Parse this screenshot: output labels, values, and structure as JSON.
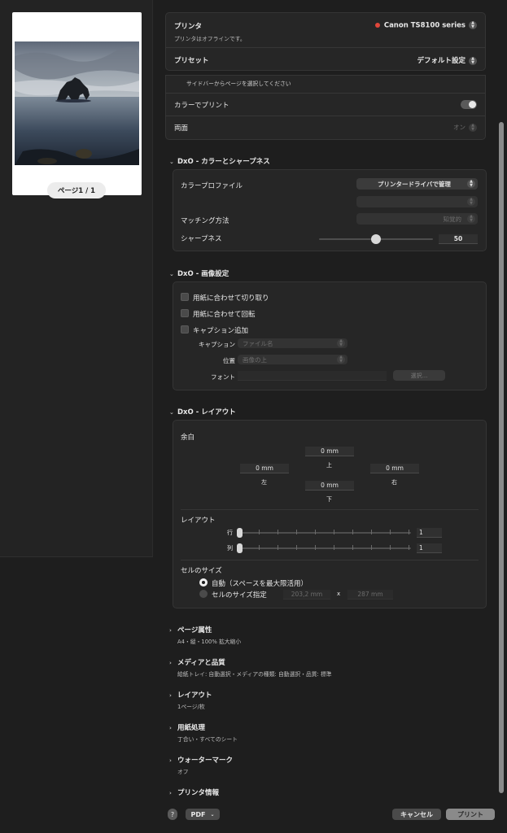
{
  "preview": {
    "page_indicator": "ページ1 / 1"
  },
  "printer": {
    "label": "プリンタ",
    "value": "Canon TS8100 series",
    "status": "プリンタはオフラインです。",
    "status_color": "#e0463a"
  },
  "preset": {
    "label": "プリセット",
    "value": "デフォルト設定"
  },
  "general": {
    "hint": "サイドバーからページを選択してください",
    "color_print_label": "カラーでプリント",
    "color_print_on": true,
    "duplex_label": "両面",
    "duplex_value": "オン"
  },
  "color_sharpness": {
    "title": "DxO - カラーとシャープネス",
    "profile_label": "カラープロファイル",
    "profile_value": "プリンタードライバで管理",
    "matching_label": "マッチング方法",
    "matching_value": "知覚的",
    "sharpness_label": "シャープネス",
    "sharpness_value": "50",
    "sharpness_level": 0.5
  },
  "image_settings": {
    "title": "DxO - 画像設定",
    "crop_label": "用紙に合わせて切り取り",
    "rotate_label": "用紙に合わせて回転",
    "caption_add_label": "キャプション追加",
    "caption_label": "キャプション",
    "caption_value": "ファイル名",
    "position_label": "位置",
    "position_value": "画像の上",
    "font_label": "フォント",
    "font_button": "選択..."
  },
  "layout_section": {
    "title": "DxO - レイアウト",
    "margins_label": "余白",
    "top_value": "0 mm",
    "top_label": "上",
    "left_value": "0 mm",
    "left_label": "左",
    "right_value": "0 mm",
    "right_label": "右",
    "bottom_value": "0 mm",
    "bottom_label": "下",
    "layout_label": "レイアウト",
    "rows_label": "行",
    "rows_value": "1",
    "cols_label": "列",
    "cols_value": "1",
    "cell_size_label": "セルのサイズ",
    "auto_label": "自動（スペースを最大限活用）",
    "custom_label": "セルのサイズ指定",
    "width_value": "203,2 mm",
    "times": "x",
    "height_value": "287 mm"
  },
  "collapsed": [
    {
      "title": "ページ属性",
      "summary": "A4・縦・100% 拡大縮小"
    },
    {
      "title": "メディアと品質",
      "summary": "給紙トレイ: 自動選択・メディアの種類: 自動選択・品質: 標準"
    },
    {
      "title": "レイアウト",
      "summary": "1ページ/枚"
    },
    {
      "title": "用紙処理",
      "summary": "丁合い・すべてのシート"
    },
    {
      "title": "ウォーターマーク",
      "summary": "オフ"
    },
    {
      "title": "プリンタ情報",
      "summary": ""
    }
  ],
  "footer": {
    "help": "?",
    "pdf": "PDF",
    "cancel": "キャンセル",
    "print": "プリント"
  }
}
